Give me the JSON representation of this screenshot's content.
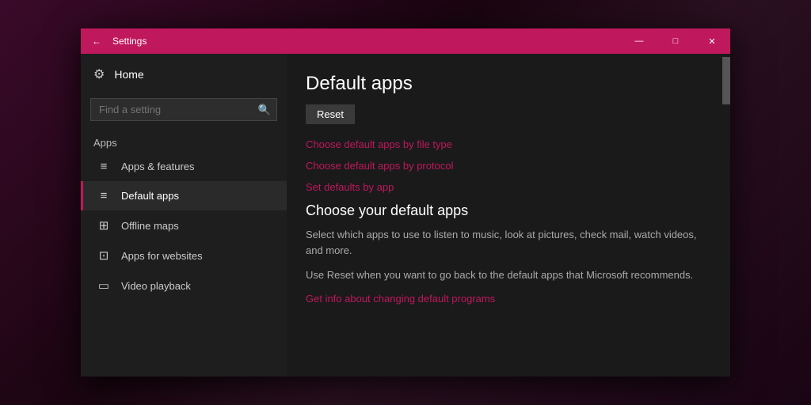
{
  "titlebar": {
    "title": "Settings",
    "back_label": "←",
    "minimize": "—",
    "restore": "□",
    "close": "✕"
  },
  "sidebar": {
    "home_label": "Home",
    "search_placeholder": "Find a setting",
    "search_icon": "🔍",
    "section_label": "Apps",
    "nav_items": [
      {
        "id": "apps-features",
        "icon": "☰",
        "label": "Apps & features",
        "active": false
      },
      {
        "id": "default-apps",
        "icon": "☰",
        "label": "Default apps",
        "active": true
      },
      {
        "id": "offline-maps",
        "icon": "⊞",
        "label": "Offline maps",
        "active": false
      },
      {
        "id": "apps-websites",
        "icon": "⊡",
        "label": "Apps for websites",
        "active": false
      },
      {
        "id": "video-playback",
        "icon": "⊟",
        "label": "Video playback",
        "active": false
      }
    ]
  },
  "main": {
    "page_title": "Default apps",
    "reset_button": "Reset",
    "links": [
      {
        "id": "by-file-type",
        "text": "Choose default apps by file type"
      },
      {
        "id": "by-protocol",
        "text": "Choose default apps by protocol"
      },
      {
        "id": "by-app",
        "text": "Set defaults by app"
      }
    ],
    "choose_heading": "Choose your default apps",
    "description1": "Select which apps to use to listen to music, look at pictures, check mail, watch videos, and more.",
    "description2": "Use Reset when you want to go back to the default apps that Microsoft recommends.",
    "info_link": "Get info about changing default programs"
  }
}
